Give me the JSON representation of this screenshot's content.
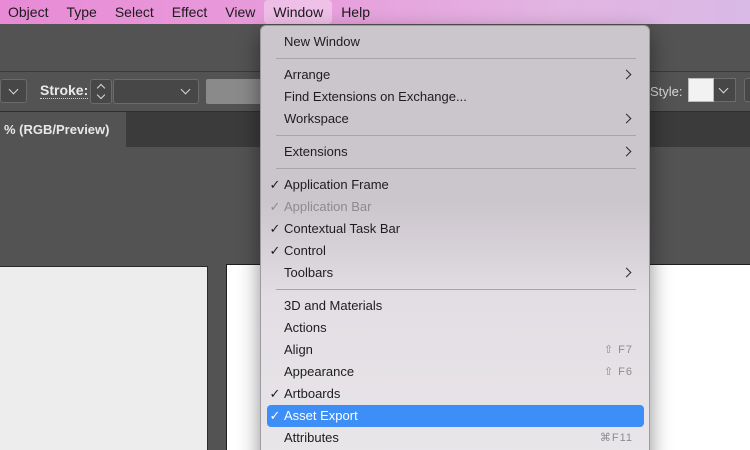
{
  "menubar": {
    "items": [
      "Object",
      "Type",
      "Select",
      "Effect",
      "View",
      "Window",
      "Help"
    ],
    "active": "Window"
  },
  "control": {
    "stroke_label": "Stroke:",
    "style_label": "Style:"
  },
  "document": {
    "tab_title": "% (RGB/Preview)"
  },
  "window_menu": {
    "items": [
      {
        "label": "New Window",
        "check": "",
        "submenu": false,
        "shortcut": "",
        "disabled": false,
        "selected": false
      },
      {
        "label": "Arrange",
        "check": "",
        "submenu": true,
        "shortcut": "",
        "disabled": false,
        "selected": false
      },
      {
        "label": "Find Extensions on Exchange...",
        "check": "",
        "submenu": false,
        "shortcut": "",
        "disabled": false,
        "selected": false
      },
      {
        "label": "Workspace",
        "check": "",
        "submenu": true,
        "shortcut": "",
        "disabled": false,
        "selected": false
      },
      {
        "label": "Extensions",
        "check": "",
        "submenu": true,
        "shortcut": "",
        "disabled": false,
        "selected": false
      },
      {
        "label": "Application Frame",
        "check": "✓",
        "submenu": false,
        "shortcut": "",
        "disabled": false,
        "selected": false
      },
      {
        "label": "Application Bar",
        "check": "✓",
        "submenu": false,
        "shortcut": "",
        "disabled": true,
        "selected": false
      },
      {
        "label": "Contextual Task Bar",
        "check": "✓",
        "submenu": false,
        "shortcut": "",
        "disabled": false,
        "selected": false
      },
      {
        "label": "Control",
        "check": "✓",
        "submenu": false,
        "shortcut": "",
        "disabled": false,
        "selected": false
      },
      {
        "label": "Toolbars",
        "check": "",
        "submenu": true,
        "shortcut": "",
        "disabled": false,
        "selected": false
      },
      {
        "label": "3D and Materials",
        "check": "",
        "submenu": false,
        "shortcut": "",
        "disabled": false,
        "selected": false
      },
      {
        "label": "Actions",
        "check": "",
        "submenu": false,
        "shortcut": "",
        "disabled": false,
        "selected": false
      },
      {
        "label": "Align",
        "check": "",
        "submenu": false,
        "shortcut": "⇧ F7",
        "disabled": false,
        "selected": false
      },
      {
        "label": "Appearance",
        "check": "",
        "submenu": false,
        "shortcut": "⇧ F6",
        "disabled": false,
        "selected": false
      },
      {
        "label": "Artboards",
        "check": "✓",
        "submenu": false,
        "shortcut": "",
        "disabled": false,
        "selected": false
      },
      {
        "label": "Asset Export",
        "check": "✓",
        "submenu": false,
        "shortcut": "",
        "disabled": false,
        "selected": true
      },
      {
        "label": "Attributes",
        "check": "",
        "submenu": false,
        "shortcut": "⌘F11",
        "disabled": false,
        "selected": false
      }
    ]
  },
  "colors": {
    "selection": "#3d8ef7",
    "menubar_accent": "#e88ad6",
    "app_bg": "#535353"
  }
}
